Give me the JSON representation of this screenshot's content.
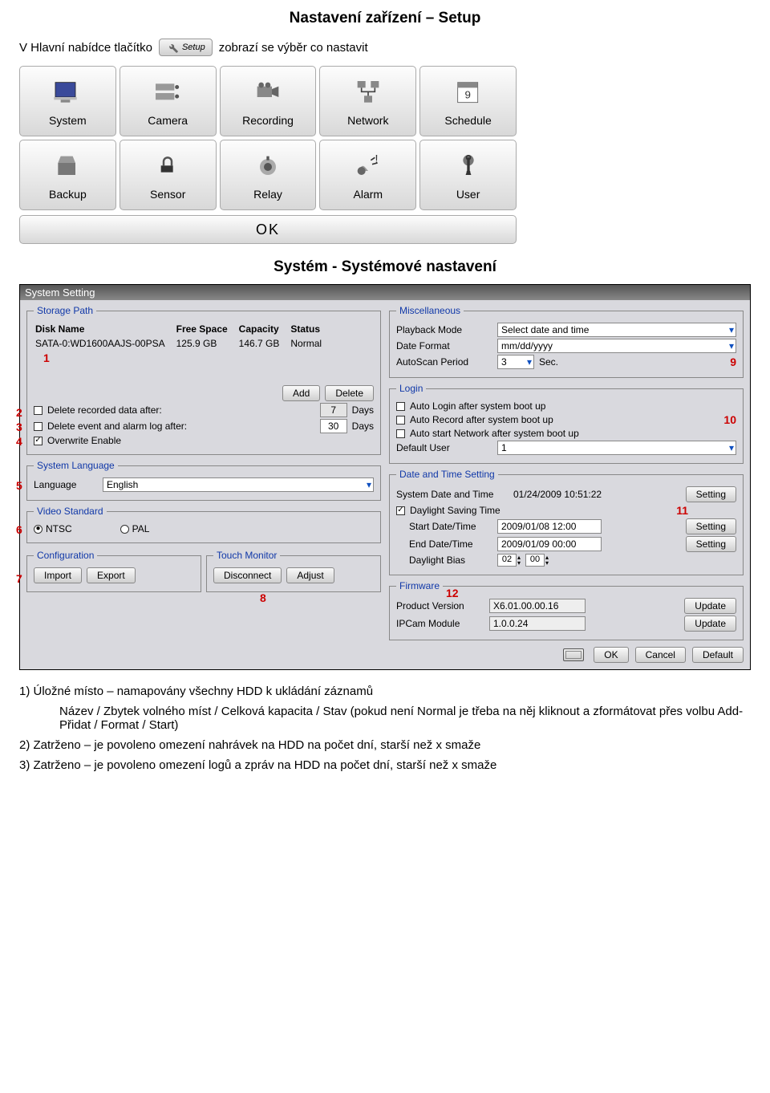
{
  "page": {
    "title": "Nastavení zařízení – Setup",
    "intro_prefix": "V Hlavní nabídce tlačítko",
    "setup_button_label": "Setup",
    "intro_suffix": "zobrazí se výběr co nastavit"
  },
  "menu": {
    "items": [
      {
        "label": "System"
      },
      {
        "label": "Camera"
      },
      {
        "label": "Recording"
      },
      {
        "label": "Network"
      },
      {
        "label": "Schedule"
      },
      {
        "label": "Backup"
      },
      {
        "label": "Sensor"
      },
      {
        "label": "Relay"
      },
      {
        "label": "Alarm"
      },
      {
        "label": "User"
      }
    ],
    "ok_label": "OK"
  },
  "section_title": "Systém - Systémové nastavení",
  "panel": {
    "title": "System Setting",
    "storage": {
      "legend": "Storage Path",
      "cols": {
        "name": "Disk Name",
        "free": "Free Space",
        "cap": "Capacity",
        "status": "Status"
      },
      "row": {
        "name": "SATA-0:WD1600AAJS-00PSA",
        "free": "125.9 GB",
        "cap": "146.7 GB",
        "status": "Normal"
      },
      "annot1": "1",
      "add": "Add",
      "delete": "Delete",
      "del_rec_label": "Delete recorded data after:",
      "del_rec_days": "7",
      "days": "Days",
      "del_evt_label": "Delete event and alarm log after:",
      "del_evt_days": "30",
      "overwrite": "Overwrite Enable",
      "annot2": "2",
      "annot3": "3",
      "annot4": "4"
    },
    "lang": {
      "legend": "System Language",
      "label": "Language",
      "value": "English",
      "annot": "5"
    },
    "video": {
      "legend": "Video Standard",
      "ntsc": "NTSC",
      "pal": "PAL",
      "annot": "6"
    },
    "config": {
      "legend": "Configuration",
      "import": "Import",
      "export": "Export",
      "annot": "7"
    },
    "touch": {
      "legend": "Touch Monitor",
      "disconnect": "Disconnect",
      "adjust": "Adjust",
      "annot": "8"
    },
    "misc": {
      "legend": "Miscellaneous",
      "playback": "Playback Mode",
      "playback_val": "Select date and time",
      "datefmt": "Date Format",
      "datefmt_val": "mm/dd/yyyy",
      "autoscan": "AutoScan Period",
      "autoscan_val": "3",
      "sec": "Sec.",
      "annot": "9"
    },
    "login": {
      "legend": "Login",
      "auto_login": "Auto Login after system boot up",
      "auto_record": "Auto Record after system boot up",
      "auto_network": "Auto start Network after system boot up",
      "default_user": "Default User",
      "default_user_val": "1",
      "annot": "10"
    },
    "datetime": {
      "legend": "Date and Time Setting",
      "sys": "System Date and Time",
      "sys_val": "01/24/2009  10:51:22",
      "setting": "Setting",
      "dst": "Daylight Saving Time",
      "start": "Start Date/Time",
      "start_val": "2009/01/08  12:00",
      "end": "End Date/Time",
      "end_val": "2009/01/09  00:00",
      "bias": "Daylight Bias",
      "bias_h": "02",
      "bias_m": "00",
      "annot": "11"
    },
    "firmware": {
      "legend": "Firmware",
      "product": "Product Version",
      "product_val": "X6.01.00.00.16",
      "ipcam": "IPCam Module",
      "ipcam_val": "1.0.0.24",
      "update": "Update",
      "annot": "12"
    },
    "bottom": {
      "ok": "OK",
      "cancel": "Cancel",
      "default": "Default"
    }
  },
  "notes": {
    "n1": "1) Úložné místo – namapovány všechny HDD k ukládání záznamů",
    "n1b": "Název / Zbytek volného míst / Celková kapacita / Stav (pokud není Normal je třeba na něj kliknout a zformátovat přes volbu Add-Přidat / Format / Start)",
    "n2": "2) Zatrženo – je povoleno omezení nahrávek na HDD na počet dní, starší než x smaže",
    "n3": "3) Zatrženo – je povoleno omezení logů a zpráv na HDD na počet dní, starší než x smaže"
  }
}
